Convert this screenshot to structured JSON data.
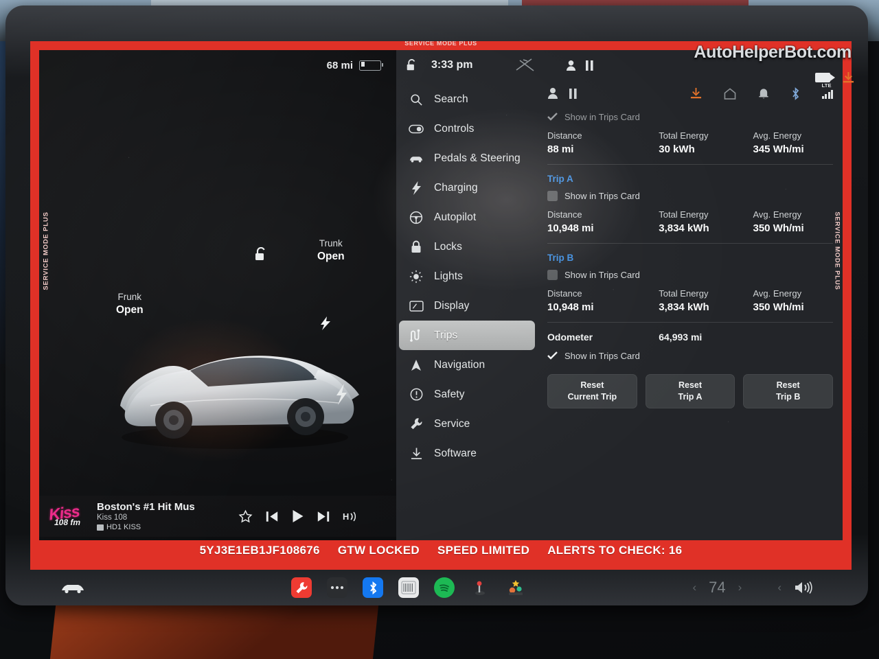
{
  "watermark": "AutoHelperBot.com",
  "service_mode": {
    "top_label": "SERVICE MODE PLUS",
    "side_label_left": "SERVICE MODE PLUS",
    "side_label_right": "SERVICE MODE PLUS",
    "frame_color": "#e03127"
  },
  "status_bar": {
    "range": "68 mi",
    "clock": "3:33 pm",
    "lock_icon": "unlock-icon",
    "wiper_icon": "wiper-icon",
    "profile_icon": "profile-icon",
    "pause_icon": "pause-icon"
  },
  "car_view": {
    "frunk": {
      "label": "Frunk",
      "state": "Open"
    },
    "trunk": {
      "label": "Trunk",
      "state": "Open"
    },
    "lock_icon": "unlock-icon",
    "charge_icon": "charge-bolt-icon"
  },
  "media": {
    "station_logo": "kiss-108-logo",
    "logo_text_main": "Kiss",
    "logo_text_sub": "108 fm",
    "title": "Boston's #1 Hit Mus",
    "subtitle": "Kiss 108",
    "hd_label": "HD1 KISS",
    "controls": [
      "favorite-star-icon",
      "previous-track-icon",
      "play-icon",
      "next-track-icon",
      "hd-radio-icon"
    ]
  },
  "sidebar": {
    "items": [
      {
        "label": "Search",
        "icon": "search-icon",
        "active": false
      },
      {
        "label": "Controls",
        "icon": "toggle-icon",
        "active": false
      },
      {
        "label": "Pedals & Steering",
        "icon": "car-icon",
        "active": false
      },
      {
        "label": "Charging",
        "icon": "bolt-icon",
        "active": false
      },
      {
        "label": "Autopilot",
        "icon": "steering-wheel-icon",
        "active": false
      },
      {
        "label": "Locks",
        "icon": "lock-icon",
        "active": false
      },
      {
        "label": "Lights",
        "icon": "sun-icon",
        "active": false
      },
      {
        "label": "Display",
        "icon": "display-icon",
        "active": false
      },
      {
        "label": "Trips",
        "icon": "trips-icon",
        "active": true
      },
      {
        "label": "Navigation",
        "icon": "navigation-arrow-icon",
        "active": false
      },
      {
        "label": "Safety",
        "icon": "alert-circle-icon",
        "active": false
      },
      {
        "label": "Service",
        "icon": "wrench-icon",
        "active": false
      },
      {
        "label": "Software",
        "icon": "download-icon",
        "active": false
      }
    ]
  },
  "panel_icons": {
    "left": [
      "profile-icon",
      "pause-icon"
    ],
    "right": [
      "download-icon",
      "home-icon",
      "bell-icon",
      "bluetooth-icon",
      "lte-signal-icon"
    ],
    "lte_label": "LTE",
    "download_color": "#e2722a"
  },
  "trips": {
    "current": {
      "show_in_trips_card": {
        "label": "Show in Trips Card",
        "checked": true,
        "dimmed": true
      },
      "stats": [
        {
          "key": "Distance",
          "value": "88 mi"
        },
        {
          "key": "Total Energy",
          "value": "30 kWh"
        },
        {
          "key": "Avg. Energy",
          "value": "345 Wh/mi"
        }
      ]
    },
    "trip_a": {
      "title": "Trip A",
      "show_in_trips_card": {
        "label": "Show in Trips Card",
        "checked": false,
        "dimmed": false
      },
      "stats": [
        {
          "key": "Distance",
          "value": "10,948 mi"
        },
        {
          "key": "Total Energy",
          "value": "3,834 kWh"
        },
        {
          "key": "Avg. Energy",
          "value": "350 Wh/mi"
        }
      ]
    },
    "trip_b": {
      "title": "Trip B",
      "show_in_trips_card": {
        "label": "Show in Trips Card",
        "checked": false,
        "dimmed": false
      },
      "stats": [
        {
          "key": "Distance",
          "value": "10,948 mi"
        },
        {
          "key": "Total Energy",
          "value": "3,834 kWh"
        },
        {
          "key": "Avg. Energy",
          "value": "350 Wh/mi"
        }
      ]
    },
    "odometer": {
      "key": "Odometer",
      "value": "64,993 mi",
      "show_in_trips_card": {
        "label": "Show in Trips Card",
        "checked": true,
        "dimmed": false
      }
    },
    "buttons": [
      {
        "line1": "Reset",
        "line2": "Current Trip"
      },
      {
        "line1": "Reset",
        "line2": "Trip A"
      },
      {
        "line1": "Reset",
        "line2": "Trip B"
      }
    ]
  },
  "alert_strip": {
    "vin": "5YJ3E1EB1JF108676",
    "gtw": "GTW LOCKED",
    "speed": "SPEED LIMITED",
    "alerts": "ALERTS TO CHECK: 16"
  },
  "taskbar": {
    "car_icon": "car-icon",
    "apps": [
      {
        "name": "service-mode-app",
        "icon": "wrench-icon",
        "color": "#ef3b32"
      },
      {
        "name": "more-apps",
        "icon": "ellipsis-icon",
        "color": "#2b2d30"
      },
      {
        "name": "bluetooth-app",
        "icon": "bluetooth-icon",
        "color": "#1478f0"
      },
      {
        "name": "radio-app",
        "icon": "radio-icon",
        "color": "#e8e9ea"
      },
      {
        "name": "spotify-app",
        "icon": "spotify-icon",
        "color": "#1db954"
      },
      {
        "name": "arcade-app",
        "icon": "joystick-icon",
        "color": "#e2413f"
      },
      {
        "name": "toybox-app",
        "icon": "toybox-icon",
        "color": "#f2c230"
      }
    ],
    "temperature": "74",
    "left_chevron": "‹",
    "right_chevron": "›",
    "volume_icon": "volume-icon"
  },
  "overlay_icons": {
    "dashcam": "dashcam-icon",
    "download": "download-icon",
    "download_color": "#e2722a"
  }
}
